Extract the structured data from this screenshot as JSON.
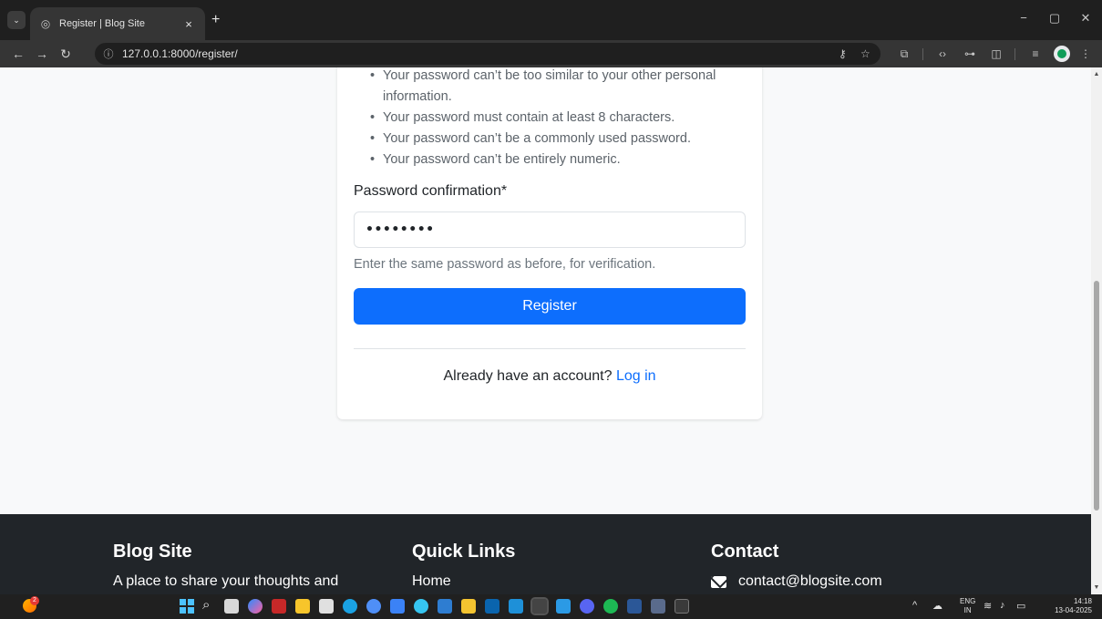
{
  "browser": {
    "tab_title": "Register | Blog Site",
    "tab_close": "×",
    "new_tab": "+",
    "url": "127.0.0.1:8000/register/"
  },
  "form": {
    "password_help": [
      "Your password can’t be too similar to your other personal information.",
      "Your password must contain at least 8 characters.",
      "Your password can’t be a commonly used password.",
      "Your password can’t be entirely numeric."
    ],
    "confirmation_label": "Password confirmation*",
    "confirmation_value": "••••••••",
    "confirmation_help": "Enter the same password as before, for verification.",
    "register_button": "Register",
    "login_prompt": "Already have an account?",
    "login_link": "Log in"
  },
  "footer": {
    "brand_title": "Blog Site",
    "brand_text": "A place to share your thoughts and",
    "links_title": "Quick Links",
    "links_first": "Home",
    "contact_title": "Contact",
    "contact_email": "contact@blogsite.com"
  },
  "taskbar": {
    "notification_count": "2",
    "lang_line1": "ENG",
    "lang_line2": "IN",
    "time": "14:18",
    "date": "13-04-2025"
  },
  "colors": {
    "primary": "#0d6efd",
    "footer_bg": "#212529",
    "page_bg": "#f8f9fa"
  }
}
